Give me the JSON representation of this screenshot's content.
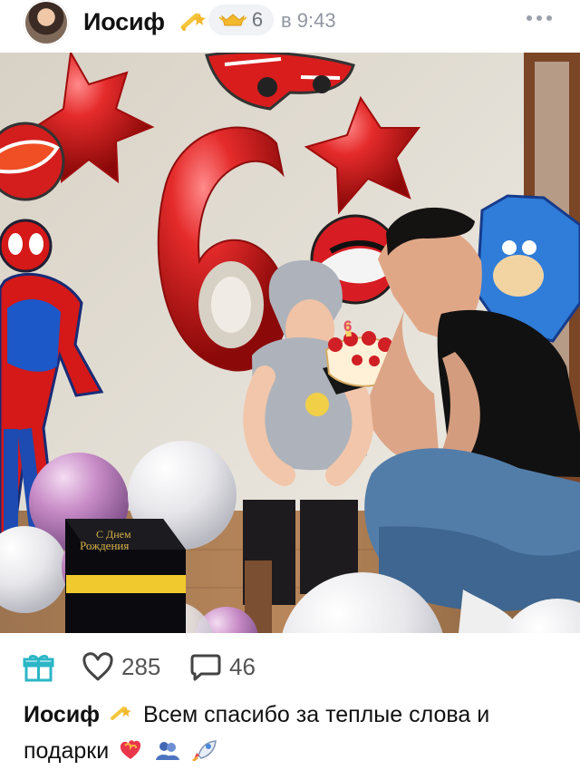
{
  "header": {
    "author": "Иосиф",
    "level": "6",
    "time": "в 9:43",
    "icons": [
      "avatar",
      "sparkle-emoji",
      "level-badge-icon",
      "more-icon"
    ]
  },
  "photo": {
    "balloon_number": "6",
    "box_text_1": "С Днем",
    "box_text_2": "Рождения"
  },
  "actions": {
    "likes": "285",
    "comments": "46",
    "icons": [
      "gift-icon",
      "heart-outline-icon",
      "comment-outline-icon"
    ]
  },
  "caption": {
    "author": "Иосиф",
    "text_line_1": "Всем спасибо за теплые слова и",
    "text_line_2": "подарки",
    "emojis": [
      "sparkle-emoji",
      "heart-on-fire-emoji",
      "people-emoji",
      "rocket-emoji"
    ]
  },
  "colors": {
    "accent": "#2bb6c6",
    "text": "#111111",
    "muted": "#9297a0",
    "emoji_yellow": "#f2b82e",
    "balloon_red": "#d81e1e"
  }
}
